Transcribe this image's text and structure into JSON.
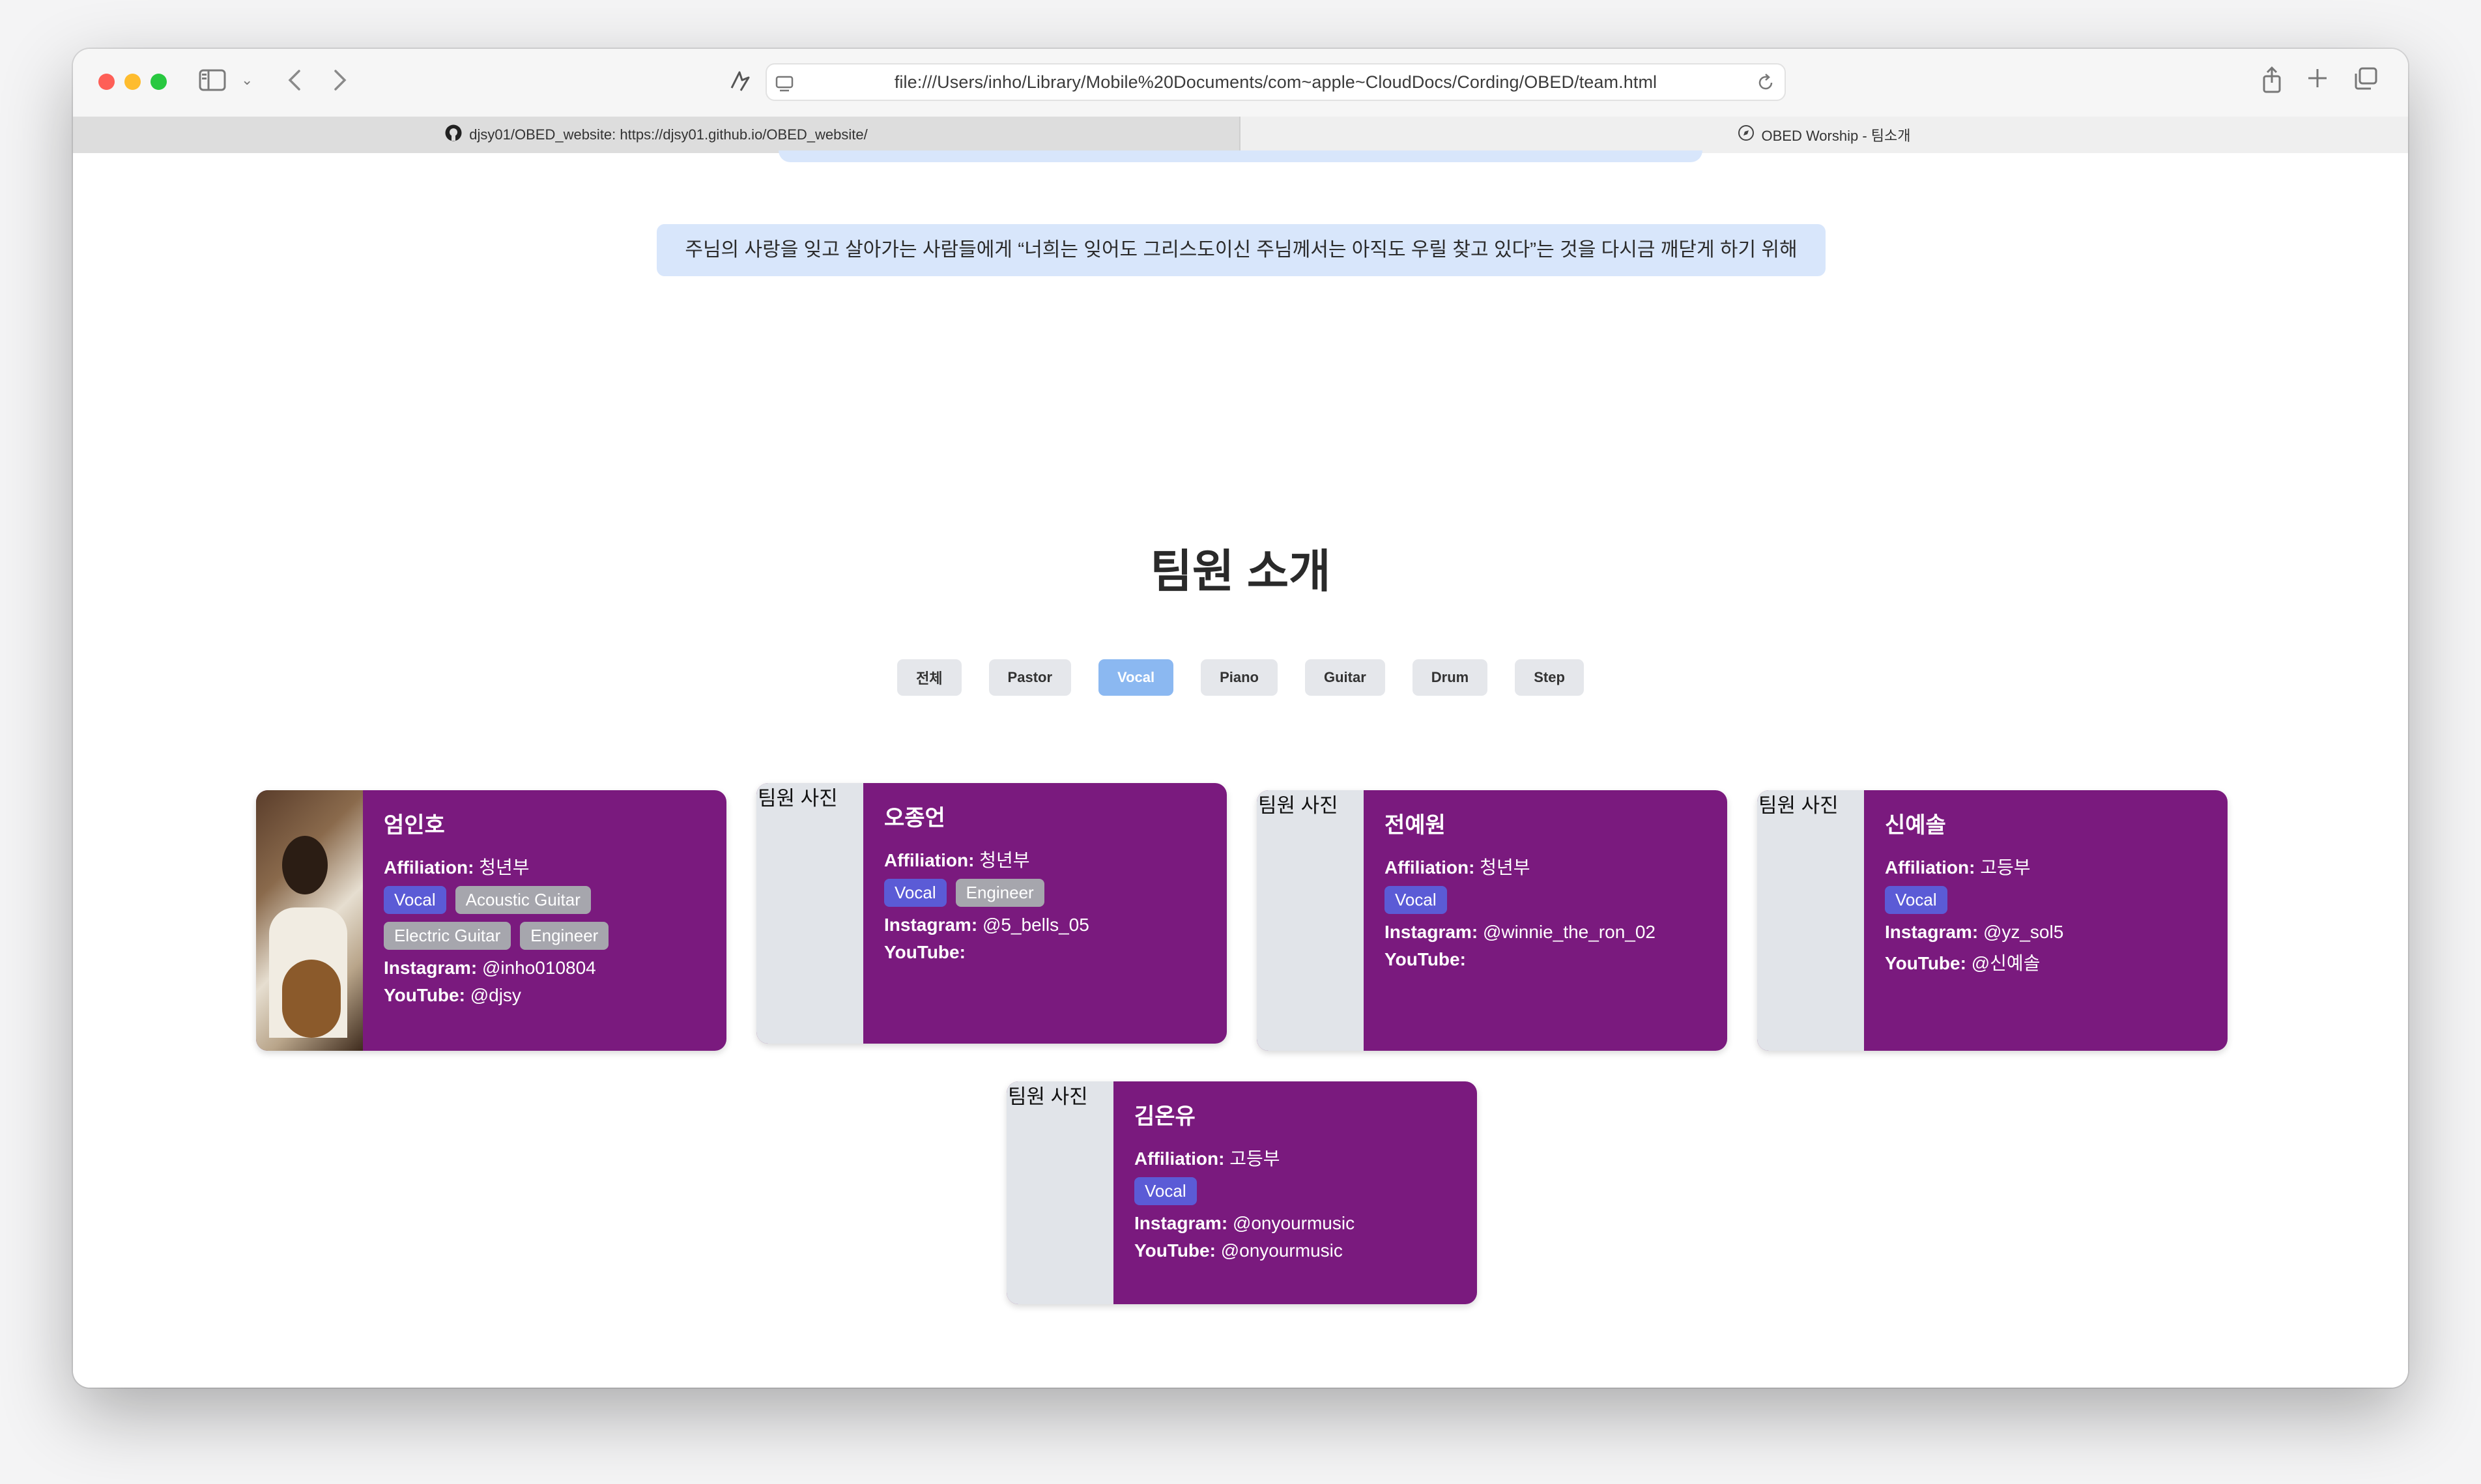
{
  "browser": {
    "address": "file:///Users/inho/Library/Mobile%20Documents/com~apple~CloudDocs/Cording/OBED/team.html",
    "tabs": [
      {
        "label": "djsy01/OBED_website: https://djsy01.github.io/OBED_website/",
        "icon": "github-icon"
      },
      {
        "label": "OBED Worship - 팀소개",
        "icon": "compass-icon"
      }
    ]
  },
  "page": {
    "banner": "주님의 사랑을 잊고 살아가는 사람들에게 “너희는 잊어도 그리스도이신 주님께서는 아직도 우릴 찾고 있다”는 것을 다시금 깨닫게 하기 위해",
    "title": "팀원 소개",
    "filters": [
      "전체",
      "Pastor",
      "Vocal",
      "Piano",
      "Guitar",
      "Drum",
      "Step"
    ],
    "active_filter": "Vocal",
    "labels": {
      "affiliation": "Affiliation:",
      "instagram": "Instagram:",
      "youtube": "YouTube:",
      "photo_alt": "팀원 사진"
    },
    "members": [
      {
        "name": "엄인호",
        "affiliation": "청년부",
        "tags": [
          "Vocal",
          "Acoustic Guitar",
          "Electric Guitar",
          "Engineer"
        ],
        "instagram": "@inho010804",
        "youtube": "@djsy"
      },
      {
        "name": "오종언",
        "affiliation": "청년부",
        "tags": [
          "Vocal",
          "Engineer"
        ],
        "instagram": "@5_bells_05",
        "youtube": ""
      },
      {
        "name": "전예원",
        "affiliation": "청년부",
        "tags": [
          "Vocal"
        ],
        "instagram": "@winnie_the_ron_02",
        "youtube": ""
      },
      {
        "name": "신예솔",
        "affiliation": "고등부",
        "tags": [
          "Vocal"
        ],
        "instagram": "@yz_sol5",
        "youtube": "@신예솔"
      },
      {
        "name": "김온유",
        "affiliation": "고등부",
        "tags": [
          "Vocal"
        ],
        "instagram": "@onyourmusic",
        "youtube": "@onyourmusic"
      }
    ]
  },
  "colors": {
    "card": "#7a1a7e",
    "active_filter": "#8bb8f1",
    "vocal_tag": "#5b5bd6",
    "other_tag": "#a6a6ad",
    "banner": "#d8e6fb"
  }
}
